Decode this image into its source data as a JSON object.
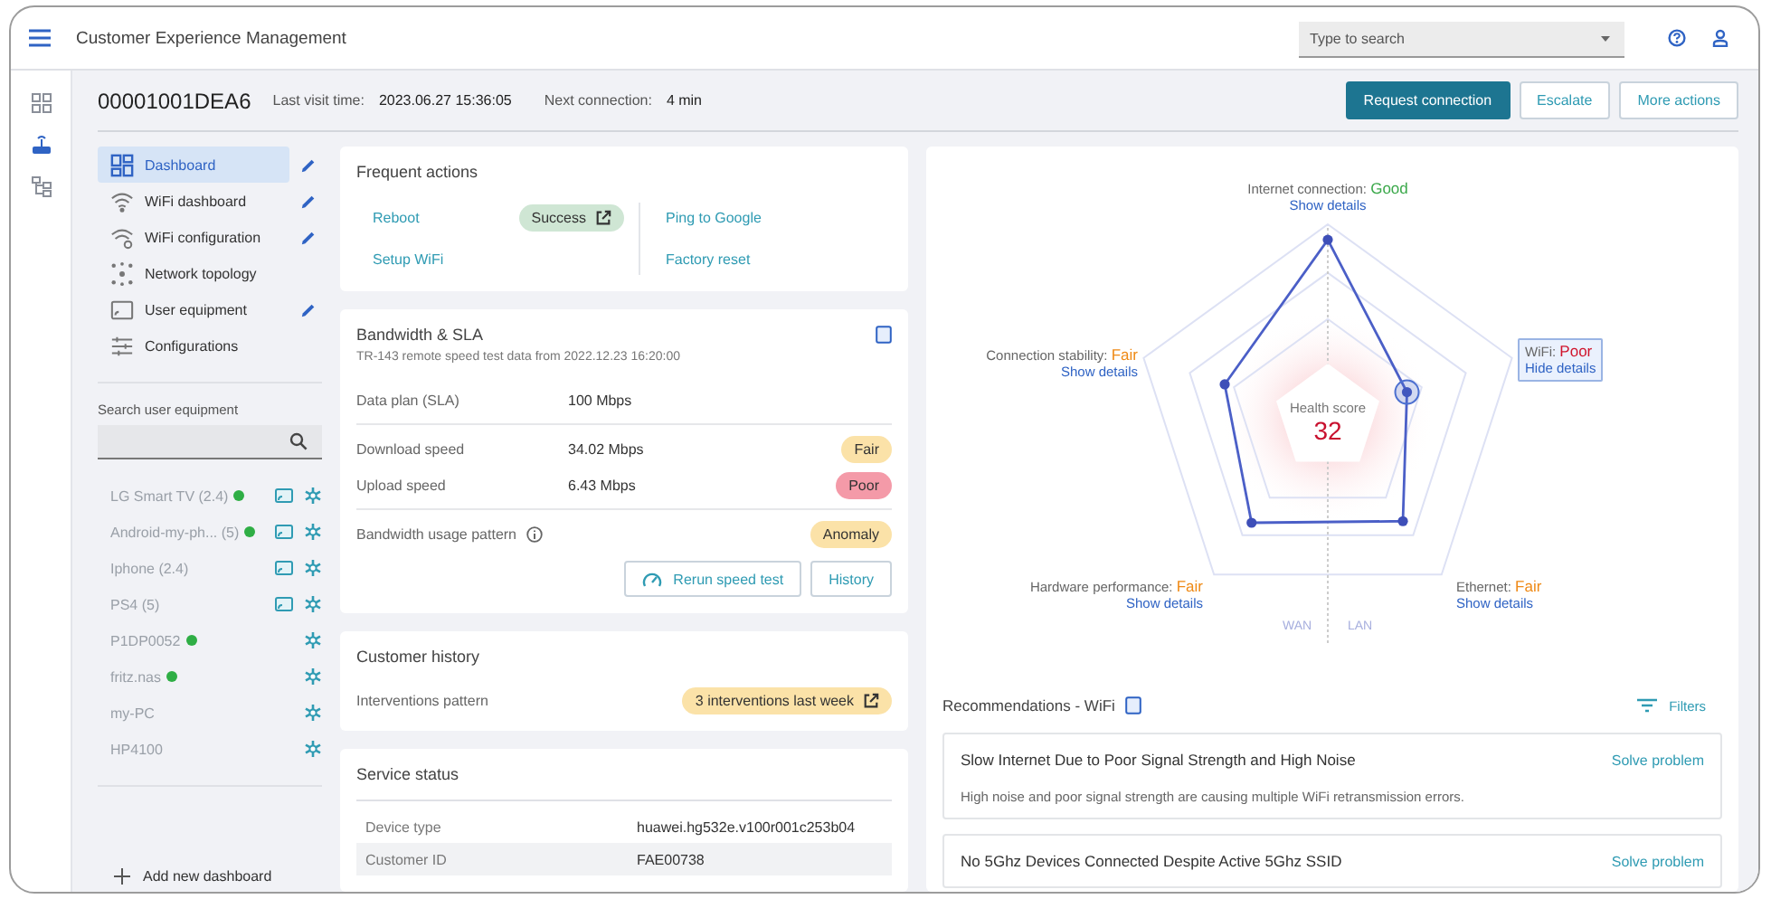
{
  "app": {
    "title": "Customer Experience Management"
  },
  "search": {
    "placeholder": "Type to search"
  },
  "rail": [
    {
      "selected": false
    },
    {
      "selected": true
    },
    {
      "selected": false
    }
  ],
  "customer": {
    "id": "00001001DEA6",
    "last_visit_label": "Last visit time:",
    "last_visit": "2023.06.27 15:36:05",
    "next_connection_label": "Next connection:",
    "next_connection": "4 min"
  },
  "header_buttons": [
    {
      "label": "Request connection",
      "kind": "primary"
    },
    {
      "label": "Escalate",
      "kind": "secondary"
    },
    {
      "label": "More actions",
      "kind": "secondary"
    }
  ],
  "nav": [
    {
      "label": "Dashboard",
      "selected": true,
      "editable": true
    },
    {
      "label": "WiFi dashboard",
      "selected": false,
      "editable": true
    },
    {
      "label": "WiFi configuration",
      "selected": false,
      "editable": true
    },
    {
      "label": "Network topology",
      "selected": false,
      "editable": false
    },
    {
      "label": "User equipment",
      "selected": false,
      "editable": true
    },
    {
      "label": "Configurations",
      "selected": false,
      "editable": false
    }
  ],
  "equipment_search": {
    "label": "Search user equipment"
  },
  "devices": [
    {
      "name": "LG Smart TV (2.4)",
      "online": true,
      "kind": "screen"
    },
    {
      "name": "Android-my-ph... (5)",
      "online": true,
      "kind": "screen"
    },
    {
      "name": "Iphone (2.4)",
      "online": false,
      "kind": "screen"
    },
    {
      "name": "PS4 (5)",
      "online": false,
      "kind": "screen"
    },
    {
      "name": "P1DP0052",
      "online": true,
      "kind": "plain"
    },
    {
      "name": "fritz.nas",
      "online": true,
      "kind": "plain"
    },
    {
      "name": "my-PC",
      "online": false,
      "kind": "plain"
    },
    {
      "name": "HP4100",
      "online": false,
      "kind": "plain"
    }
  ],
  "add_dashboard": "Add new dashboard",
  "frequent_actions": {
    "title": "Frequent actions",
    "columns": [
      [
        {
          "label": "Reboot",
          "status": "Success"
        },
        {
          "label": "Setup WiFi"
        }
      ],
      [
        {
          "label": "Ping to Google"
        },
        {
          "label": "Factory reset"
        }
      ]
    ]
  },
  "bandwidth": {
    "title": "Bandwidth & SLA",
    "subtitle": "TR-143 remote speed test data from 2022.12.23 16:20:00",
    "rows": [
      {
        "label": "Data plan (SLA)",
        "value": "100 Mbps"
      },
      {
        "label": "Download speed",
        "value": "34.02 Mbps",
        "badge": {
          "text": "Fair",
          "kind": "warning"
        }
      },
      {
        "label": "Upload speed",
        "value": "6.43 Mbps",
        "badge": {
          "text": "Poor",
          "kind": "danger"
        }
      }
    ],
    "usage": {
      "label": "Bandwidth usage pattern",
      "badge": {
        "text": "Anomaly",
        "kind": "warning"
      }
    },
    "buttons": [
      "Rerun speed test",
      "History"
    ]
  },
  "customer_history": {
    "title": "Customer history",
    "label": "Interventions pattern",
    "badge": {
      "text": "3 interventions last week",
      "kind": "warning"
    }
  },
  "service_status": {
    "title": "Service status",
    "rows": [
      {
        "label": "Device type",
        "value": "huawei.hg532e.v100r001c253b04"
      },
      {
        "label": "Customer ID",
        "value": "FAE00738"
      }
    ]
  },
  "health": {
    "score_label": "Health score",
    "score": "32",
    "wan": "WAN",
    "lan": "LAN",
    "axes": [
      {
        "name": "Internet connection:",
        "status": "Good",
        "kind": "good",
        "link": "Show details",
        "expanded": false
      },
      {
        "name": "Connection stability:",
        "status": "Fair",
        "kind": "fair",
        "link": "Show details",
        "expanded": false
      },
      {
        "name": "WiFi:",
        "status": "Poor",
        "kind": "poor",
        "link": "Hide details",
        "expanded": true
      },
      {
        "name": "Hardware performance:",
        "status": "Fair",
        "kind": "fair",
        "link": "Show details",
        "expanded": false
      },
      {
        "name": "Ethernet:",
        "status": "Fair",
        "kind": "fair",
        "link": "Show details",
        "expanded": false
      }
    ]
  },
  "recommendations": {
    "title": "Recommendations - WiFi",
    "filters": "Filters",
    "items": [
      {
        "title": "Slow Internet Due to Poor Signal Strength and High Noise",
        "action": "Solve problem",
        "description": "High noise and poor signal strength are causing multiple WiFi retransmission errors."
      },
      {
        "title": "No 5Ghz Devices Connected Despite Active 5Ghz SSID",
        "action": "Solve problem"
      }
    ]
  }
}
